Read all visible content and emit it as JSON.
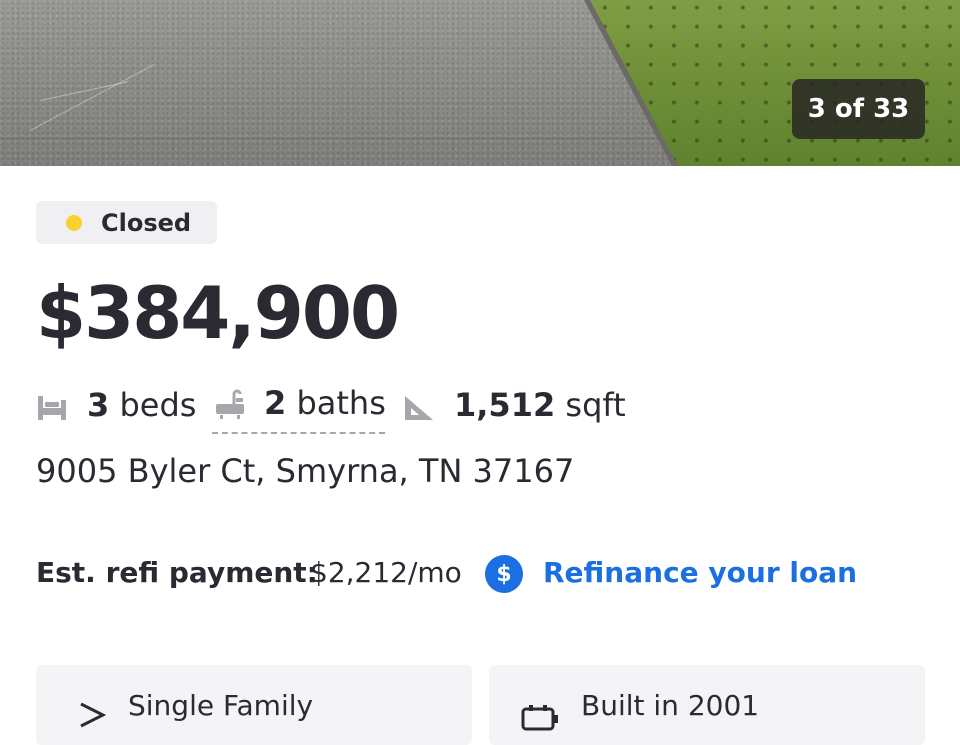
{
  "gallery": {
    "counter": "3 of 33"
  },
  "listing": {
    "status": "Closed",
    "status_color": "#f9d12f",
    "price": "$384,900",
    "beds_value": "3",
    "beds_unit": "beds",
    "baths_value": "2",
    "baths_unit": "baths",
    "sqft_value": "1,512",
    "sqft_unit": "sqft",
    "address": "9005 Byler Ct, Smyrna, TN 37167"
  },
  "refi": {
    "label": "Est. refi payment:",
    "amount": "$2,212/mo",
    "badge_symbol": "$",
    "link_text": "Refinance your loan",
    "accent_color": "#1b6fe0"
  },
  "facts_cards": [
    {
      "icon": "home-type-icon",
      "text": "Single Family"
    },
    {
      "icon": "calendar-built-icon",
      "text": "Built in 2001"
    }
  ]
}
